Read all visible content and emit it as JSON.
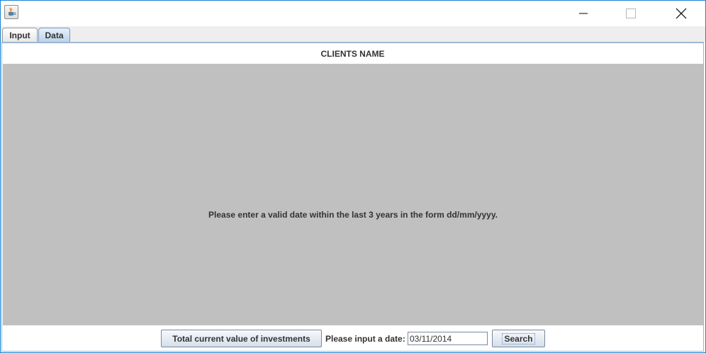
{
  "window": {
    "app_icon": "java-cup-icon",
    "controls": {
      "minimize": "minimize-icon",
      "maximize": "maximize-icon",
      "close": "close-icon"
    }
  },
  "tabs": [
    {
      "label": "Input",
      "selected": false
    },
    {
      "label": "Data",
      "selected": true
    }
  ],
  "main": {
    "header": "CLIENTS NAME",
    "message": "Please enter a valid date within the last 3 years in the form dd/mm/yyyy."
  },
  "footer": {
    "total_button_label": "Total current value of investments",
    "date_label": "Please input a date:",
    "date_value": "03/11/2014",
    "search_button_label": "Search"
  },
  "colors": {
    "window_border": "#1883d7",
    "content_background": "#c0c0c0",
    "selected_tab": "#bcd3ea"
  }
}
